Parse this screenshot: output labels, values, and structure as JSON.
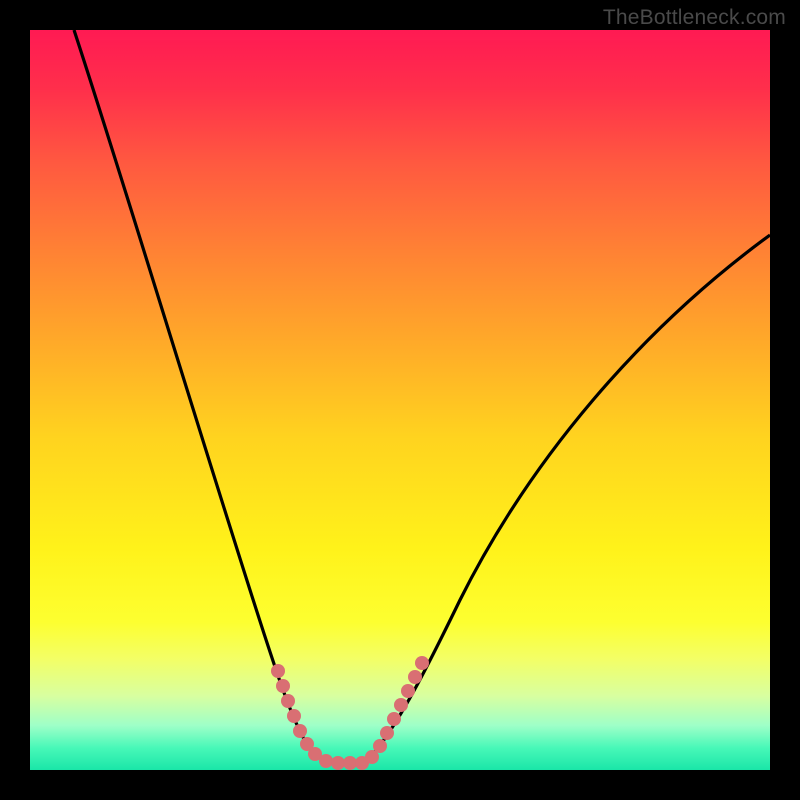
{
  "watermark": "TheBottleneck.com",
  "chart_data": {
    "type": "line",
    "title": "",
    "xlabel": "",
    "ylabel": "",
    "xlim": [
      0,
      100
    ],
    "ylim": [
      0,
      100
    ],
    "series": [
      {
        "name": "bottleneck-curve",
        "x": [
          6,
          10,
          14,
          18,
          22,
          26,
          29,
          32,
          34,
          36,
          37,
          38,
          40,
          42,
          44,
          46,
          48,
          52,
          58,
          66,
          76,
          88,
          100
        ],
        "y": [
          100,
          87,
          74,
          62,
          50,
          38,
          28,
          19,
          12,
          7,
          4,
          2,
          2,
          2,
          3,
          5,
          8,
          14,
          22,
          32,
          44,
          58,
          73
        ]
      }
    ],
    "highlight_ranges": [
      {
        "name": "left-dots",
        "x_start": 35,
        "x_end": 38
      },
      {
        "name": "right-dots",
        "x_start": 44,
        "x_end": 48
      }
    ],
    "colors": {
      "curve": "#000000",
      "dots": "#d96f73",
      "gradient_top": "#ff1a53",
      "gradient_mid": "#fff21a",
      "gradient_bottom": "#1ae6a8",
      "frame": "#000000"
    }
  }
}
